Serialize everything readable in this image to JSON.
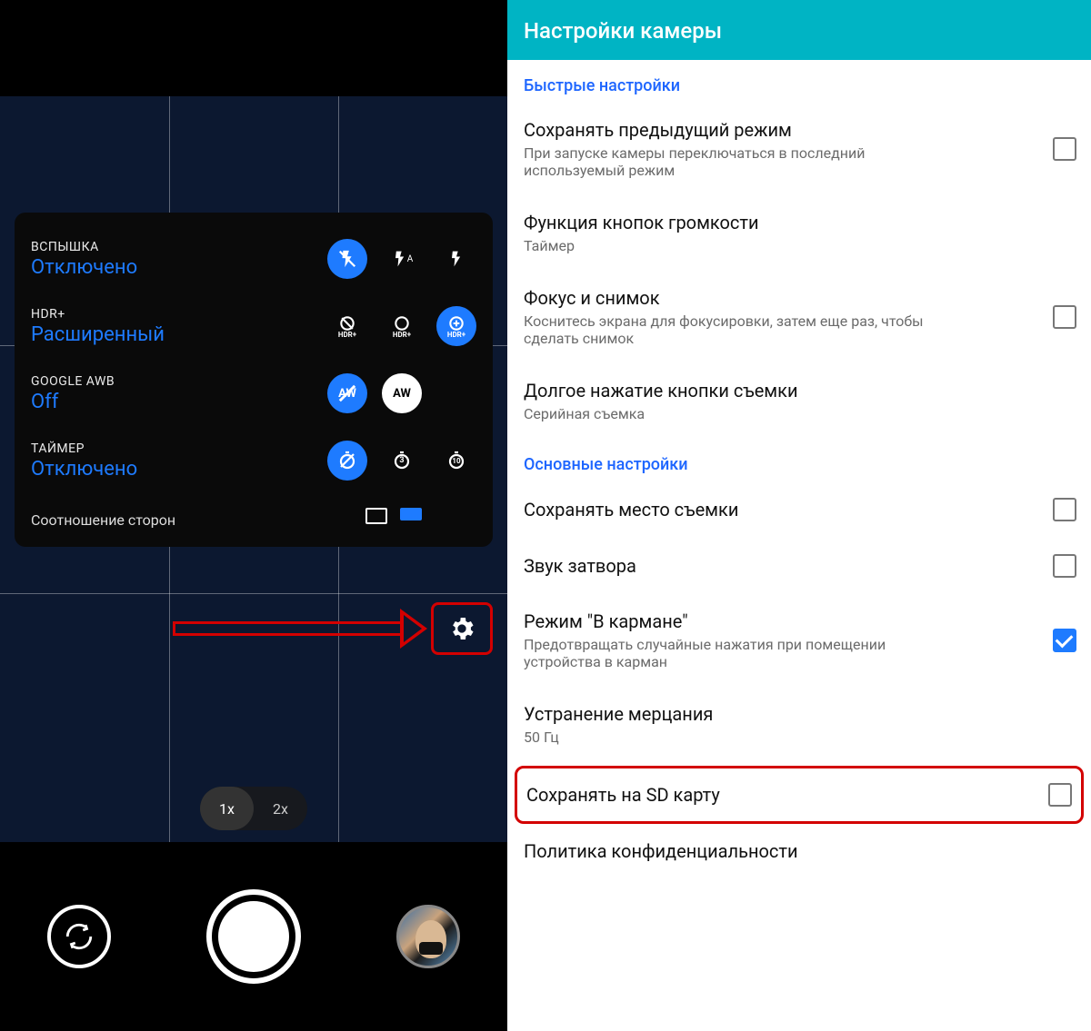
{
  "camera": {
    "quick": [
      {
        "label": "ВСПЫШКА",
        "value": "Отключено"
      },
      {
        "label": "HDR+",
        "value": "Расширенный"
      },
      {
        "label": "GOOGLE AWB",
        "value": "Off"
      },
      {
        "label": "ТАЙМЕР",
        "value": "Отключено"
      }
    ],
    "aspect": "Соотношение сторон",
    "zoom": {
      "opt1": "1x",
      "opt2": "2x"
    },
    "icon_names": {
      "flash_off": "no-flash-icon",
      "flash_auto": "flash-auto-icon",
      "flash_on": "flash-on-icon",
      "hdr_off": "hdr-off-icon",
      "hdr_on": "hdr-on-icon",
      "hdr_enh": "hdr-enh-icon",
      "awb_off": "awb-off-icon",
      "awb_on": "awb-on-icon",
      "timer_off": "timer-off-icon",
      "timer_3": "timer-3-icon",
      "timer_10": "timer-10-icon",
      "gear": "gear-icon",
      "switch": "switch-camera-icon",
      "shutter": "shutter-icon",
      "thumb": "gallery-thumb"
    }
  },
  "settings": {
    "title": "Настройки камеры",
    "section_quick": "Быстрые настройки",
    "items_quick": [
      {
        "title": "Сохранять предыдущий режим",
        "desc": "При запуске камеры переключаться в последний используемый режим",
        "checked": false,
        "checkbox": true
      },
      {
        "title": "Функция кнопок громкости",
        "desc": "Таймер",
        "checkbox": false
      },
      {
        "title": "Фокус и снимок",
        "desc": "Коснитесь экрана для фокусировки, затем еще раз, чтобы сделать снимок",
        "checked": false,
        "checkbox": true
      },
      {
        "title": "Долгое нажатие кнопки съемки",
        "desc": "Серийная съемка",
        "checkbox": false
      }
    ],
    "section_main": "Основные настройки",
    "items_main": [
      {
        "title": "Сохранять место съемки",
        "desc": "",
        "checked": false,
        "checkbox": true
      },
      {
        "title": "Звук затвора",
        "desc": "",
        "checked": false,
        "checkbox": true
      },
      {
        "title": "Режим \"В кармане\"",
        "desc": "Предотвращать случайные нажатия при помещении устройства в карман",
        "checked": true,
        "checkbox": true
      },
      {
        "title": "Устранение мерцания",
        "desc": "50 Гц",
        "checkbox": false
      }
    ],
    "sd_item": {
      "title": "Сохранять на SD карту",
      "checked": false
    },
    "privacy": "Политика конфиденциальности"
  }
}
